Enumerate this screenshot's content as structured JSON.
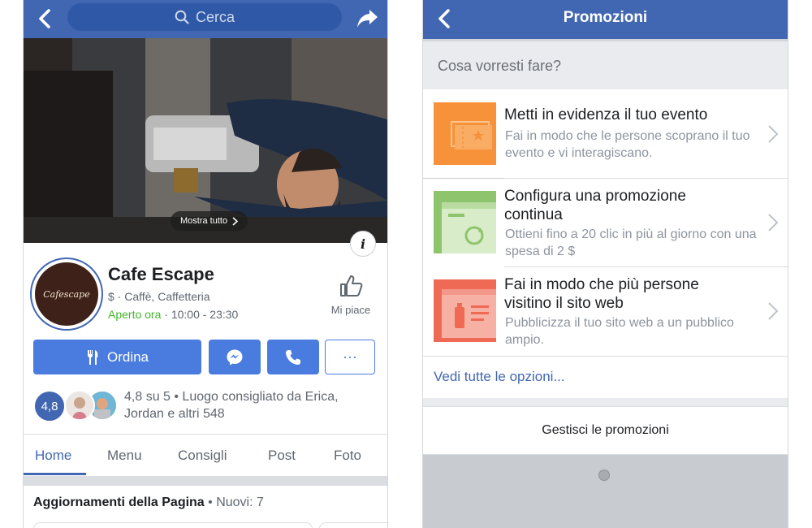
{
  "left": {
    "search_placeholder": "Cerca",
    "cover_button": "Mostra tutto",
    "info_label": "i",
    "avatar_text": "Cafescape",
    "page_name": "Cafe Escape",
    "category": "$ · Caffè, Caffetteria",
    "open_status": "Aperto ora",
    "hours": " · 10:00 - 23:30",
    "like_label": "Mi piace",
    "order_label": "Ordina",
    "more_label": "···",
    "rating_badge": "4,8",
    "rating_text": "4,8 su 5 • Luogo consigliato da Erica, Jordan e altri 548",
    "tabs": [
      "Home",
      "Menu",
      "Consigli",
      "Post",
      "Foto"
    ],
    "active_tab": "Home",
    "updates_title": "Aggiornamenti della Pagina",
    "updates_new": "Nuovi: 7"
  },
  "right": {
    "title": "Promozioni",
    "question": "Cosa vorresti fare?",
    "options": [
      {
        "title": "Metti in evidenza il tuo evento",
        "desc": "Fai in modo che le persone scoprano il tuo evento e vi interagiscano.",
        "icon": "event-ticket-icon",
        "color": "#f7923a"
      },
      {
        "title": "Configura una promozione continua",
        "desc": "Ottieni fino a 20 clic in più al giorno con una spesa di 2 $",
        "icon": "continuous-promo-icon",
        "color": "#8dc46c"
      },
      {
        "title": "Fai in modo che più persone visitino il sito web",
        "desc": "Pubblicizza il tuo sito web a un pubblico ampio.",
        "icon": "website-icon",
        "color": "#ef6a55"
      }
    ],
    "see_all": "Vedi tutte le opzioni...",
    "manage": "Gestisci le promozioni"
  },
  "colors": {
    "brand": "#4267b2",
    "button": "#4a7cdf",
    "open": "#42b72a"
  }
}
